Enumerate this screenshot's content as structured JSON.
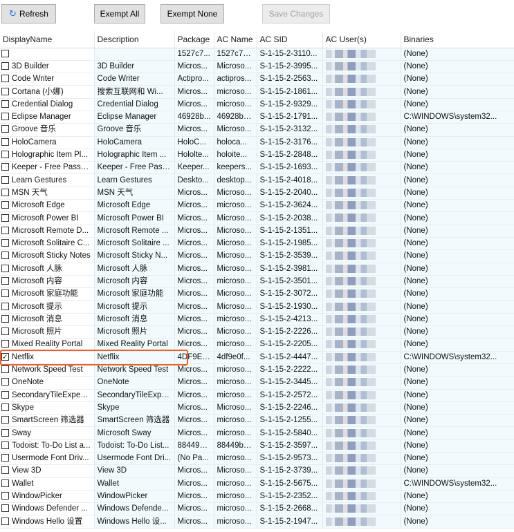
{
  "toolbar": {
    "refresh_label": "Refresh",
    "refresh_icon": "refresh-icon",
    "exempt_all_label": "Exempt All",
    "exempt_none_label": "Exempt None",
    "save_changes_label": "Save Changes"
  },
  "columns": [
    "DisplayName",
    "Description",
    "Package",
    "AC Name",
    "AC SID",
    "AC User(s)",
    "Binaries"
  ],
  "rows": [
    {
      "checked": false,
      "name": "",
      "desc": "",
      "pkg": "1527c7...",
      "ac": "1527c70...",
      "sid": "S-1-15-2-3110...",
      "bin": "(None)"
    },
    {
      "checked": false,
      "name": "3D Builder",
      "desc": "3D Builder",
      "pkg": "Micros...",
      "ac": "Microso...",
      "sid": "S-1-15-2-3995...",
      "bin": "(None)"
    },
    {
      "checked": false,
      "name": "Code Writer",
      "desc": "Code Writer",
      "pkg": "Actipro...",
      "ac": "actipros...",
      "sid": "S-1-15-2-2563...",
      "bin": "(None)"
    },
    {
      "checked": false,
      "name": "Cortana (小娜)",
      "desc": "搜索互联网和 Wi...",
      "pkg": "Micros...",
      "ac": "microso...",
      "sid": "S-1-15-2-1861...",
      "bin": "(None)"
    },
    {
      "checked": false,
      "name": "Credential Dialog",
      "desc": "Credential Dialog",
      "pkg": "Micros...",
      "ac": "microso...",
      "sid": "S-1-15-2-9329...",
      "bin": "(None)"
    },
    {
      "checked": false,
      "name": "Eclipse Manager",
      "desc": "Eclipse Manager",
      "pkg": "46928b...",
      "ac": "46928bo...",
      "sid": "S-1-15-2-1791...",
      "bin": "C:\\WINDOWS\\system32..."
    },
    {
      "checked": false,
      "name": "Groove 音乐",
      "desc": "Groove 音乐",
      "pkg": "Micros...",
      "ac": "Microso...",
      "sid": "S-1-15-2-3132...",
      "bin": "(None)"
    },
    {
      "checked": false,
      "name": "HoloCamera",
      "desc": "HoloCamera",
      "pkg": "HoloC...",
      "ac": "holoca...",
      "sid": "S-1-15-2-3176...",
      "bin": "(None)"
    },
    {
      "checked": false,
      "name": "Holographic Item Pl...",
      "desc": "Holographic Item ...",
      "pkg": "Hololte...",
      "ac": "holoite...",
      "sid": "S-1-15-2-2848...",
      "bin": "(None)"
    },
    {
      "checked": false,
      "name": "Keeper - Free Passw...",
      "desc": "Keeper - Free Pass...",
      "pkg": "Keeper...",
      "ac": "keepers...",
      "sid": "S-1-15-2-1693...",
      "bin": "(None)"
    },
    {
      "checked": false,
      "name": "Learn Gestures",
      "desc": "Learn Gestures",
      "pkg": "Deskto...",
      "ac": "desktop...",
      "sid": "S-1-15-2-4018...",
      "bin": "(None)"
    },
    {
      "checked": false,
      "name": "MSN 天气",
      "desc": "MSN 天气",
      "pkg": "Micros...",
      "ac": "Microso...",
      "sid": "S-1-15-2-2040...",
      "bin": "(None)"
    },
    {
      "checked": false,
      "name": "Microsoft Edge",
      "desc": "Microsoft Edge",
      "pkg": "Micros...",
      "ac": "microso...",
      "sid": "S-1-15-2-3624...",
      "bin": "(None)"
    },
    {
      "checked": false,
      "name": "Microsoft Power BI",
      "desc": "Microsoft Power BI",
      "pkg": "Micros...",
      "ac": "Microso...",
      "sid": "S-1-15-2-2038...",
      "bin": "(None)"
    },
    {
      "checked": false,
      "name": "Microsoft Remote D...",
      "desc": "Microsoft Remote ...",
      "pkg": "Micros...",
      "ac": "Microso...",
      "sid": "S-1-15-2-1351...",
      "bin": "(None)"
    },
    {
      "checked": false,
      "name": "Microsoft Solitaire C...",
      "desc": "Microsoft Solitaire ...",
      "pkg": "Micros...",
      "ac": "Microso...",
      "sid": "S-1-15-2-1985...",
      "bin": "(None)"
    },
    {
      "checked": false,
      "name": "Microsoft Sticky Notes",
      "desc": "Microsoft Sticky N...",
      "pkg": "Micros...",
      "ac": "Microso...",
      "sid": "S-1-15-2-3539...",
      "bin": "(None)"
    },
    {
      "checked": false,
      "name": "Microsoft 人脉",
      "desc": "Microsoft 人脉",
      "pkg": "Micros...",
      "ac": "Microso...",
      "sid": "S-1-15-2-3981...",
      "bin": "(None)"
    },
    {
      "checked": false,
      "name": "Microsoft 内容",
      "desc": "Microsoft 内容",
      "pkg": "Micros...",
      "ac": "microso...",
      "sid": "S-1-15-2-3501...",
      "bin": "(None)"
    },
    {
      "checked": false,
      "name": "Microsoft 家庭功能",
      "desc": "Microsoft 家庭功能",
      "pkg": "Micros...",
      "ac": "Microso...",
      "sid": "S-1-15-2-3072...",
      "bin": "(None)"
    },
    {
      "checked": false,
      "name": "Microsoft 提示",
      "desc": "Microsoft 提示",
      "pkg": "Micros...",
      "ac": "Microso...",
      "sid": "S-1-15-2-1930...",
      "bin": "(None)"
    },
    {
      "checked": false,
      "name": "Microsoft 消息",
      "desc": "Microsoft 消息",
      "pkg": "Micros...",
      "ac": "microso...",
      "sid": "S-1-15-2-4213...",
      "bin": "(None)"
    },
    {
      "checked": false,
      "name": "Microsoft 照片",
      "desc": "Microsoft 照片",
      "pkg": "Micros...",
      "ac": "Microso...",
      "sid": "S-1-15-2-2226...",
      "bin": "(None)"
    },
    {
      "checked": false,
      "name": "Mixed Reality Portal",
      "desc": "Mixed Reality Portal",
      "pkg": "Micros...",
      "ac": "microso...",
      "sid": "S-1-15-2-2205...",
      "bin": "(None)"
    },
    {
      "checked": true,
      "name": "Netflix",
      "desc": "Netflix",
      "pkg": "4DF9E0...",
      "ac": "4df9e0f...",
      "sid": "S-1-15-2-4447...",
      "bin": "C:\\WINDOWS\\system32..."
    },
    {
      "checked": false,
      "name": "Network Speed Test",
      "desc": "Network Speed Test",
      "pkg": "Micros...",
      "ac": "microso...",
      "sid": "S-1-15-2-2222...",
      "bin": "(None)"
    },
    {
      "checked": false,
      "name": "OneNote",
      "desc": "OneNote",
      "pkg": "Micros...",
      "ac": "microso...",
      "sid": "S-1-15-2-3445...",
      "bin": "(None)"
    },
    {
      "checked": false,
      "name": "SecondaryTileExperi...",
      "desc": "SecondaryTileExpe...",
      "pkg": "Micros...",
      "ac": "microso...",
      "sid": "S-1-15-2-2572...",
      "bin": "(None)"
    },
    {
      "checked": false,
      "name": "Skype",
      "desc": "Skype",
      "pkg": "Micros...",
      "ac": "Microso...",
      "sid": "S-1-15-2-2246...",
      "bin": "(None)"
    },
    {
      "checked": false,
      "name": "SmartScreen 筛选器",
      "desc": "SmartScreen 筛选器",
      "pkg": "Micros...",
      "ac": "microso...",
      "sid": "S-1-15-2-1255...",
      "bin": "(None)"
    },
    {
      "checked": false,
      "name": "Sway",
      "desc": "Microsoft Sway",
      "pkg": "Micros...",
      "ac": "microso...",
      "sid": "S-1-15-2-5840...",
      "bin": "(None)"
    },
    {
      "checked": false,
      "name": "Todoist: To-Do List a...",
      "desc": "Todoist: To-Do List...",
      "pkg": "88449B...",
      "ac": "88449bc...",
      "sid": "S-1-15-2-3597...",
      "bin": "(None)"
    },
    {
      "checked": false,
      "name": "Usermode Font Driv...",
      "desc": "Usermode Font Dri...",
      "pkg": "(No Pa...",
      "ac": "microso...",
      "sid": "S-1-15-2-9573...",
      "bin": "(None)"
    },
    {
      "checked": false,
      "name": "View 3D",
      "desc": "View 3D",
      "pkg": "Micros...",
      "ac": "Microso...",
      "sid": "S-1-15-2-3739...",
      "bin": "(None)"
    },
    {
      "checked": false,
      "name": "Wallet",
      "desc": "Wallet",
      "pkg": "Micros...",
      "ac": "microso...",
      "sid": "S-1-15-2-5675...",
      "bin": "C:\\WINDOWS\\system32..."
    },
    {
      "checked": false,
      "name": "WindowPicker",
      "desc": "WindowPicker",
      "pkg": "Micros...",
      "ac": "microso...",
      "sid": "S-1-15-2-2352...",
      "bin": "(None)"
    },
    {
      "checked": false,
      "name": "Windows Defender ...",
      "desc": "Windows Defende...",
      "pkg": "Micros...",
      "ac": "microso...",
      "sid": "S-1-15-2-2668...",
      "bin": "(None)"
    },
    {
      "checked": false,
      "name": "Windows Hello 设置",
      "desc": "Windows Hello 设...",
      "pkg": "Micros...",
      "ac": "microso...",
      "sid": "S-1-15-2-1947...",
      "bin": "(None)"
    }
  ],
  "highlight_color": "#e8632a"
}
